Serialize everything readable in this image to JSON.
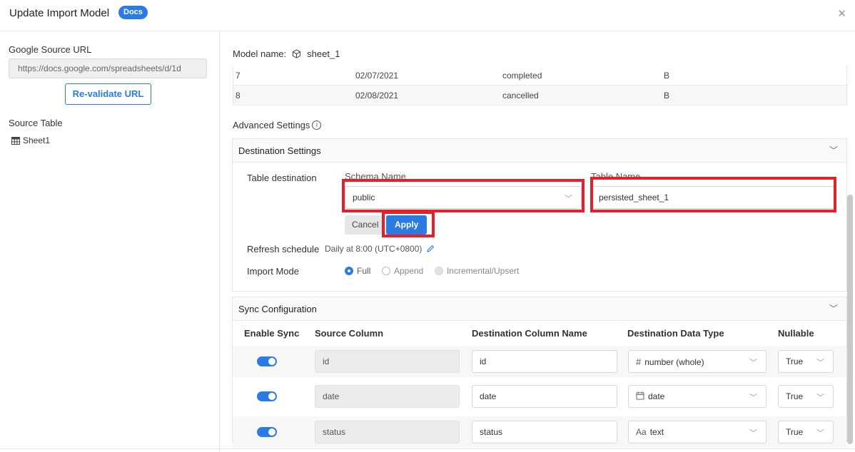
{
  "header": {
    "title": "Update Import Model",
    "docs_badge": "Docs",
    "close_icon": "close-icon"
  },
  "sidebar": {
    "google_source_label": "Google Source URL",
    "url_value": "https://docs.google.com/spreadsheets/d/1d",
    "revalidate_label": "Re-validate URL",
    "source_table_label": "Source Table",
    "sheet_name": "Sheet1"
  },
  "main": {
    "model_name_label": "Model name:",
    "model_name": "sheet_1",
    "preview_rows": [
      [
        "7",
        "02/07/2021",
        "completed",
        "B"
      ],
      [
        "8",
        "02/08/2021",
        "cancelled",
        "B"
      ]
    ],
    "advanced_settings": "Advanced Settings"
  },
  "destination": {
    "title": "Destination Settings",
    "table_destination_label": "Table destination",
    "schema_name_label": "Schema Name",
    "table_name_label": "Table Name",
    "schema_value": "public",
    "table_value": "persisted_sheet_1",
    "cancel_label": "Cancel",
    "apply_label": "Apply",
    "refresh_label": "Refresh schedule",
    "refresh_value": "Daily at 8:00 (UTC+0800)",
    "import_mode_label": "Import Mode",
    "modes": [
      "Full",
      "Append",
      "Incremental/Upsert"
    ],
    "selected_mode": "Full"
  },
  "sync": {
    "title": "Sync Configuration",
    "headers": [
      "Enable Sync",
      "Source Column",
      "Destination Column Name",
      "Destination Data Type",
      "Nullable"
    ],
    "rows": [
      {
        "source": "id",
        "dest": "id",
        "type_icon": "#",
        "type": "number (whole)",
        "nullable": "True"
      },
      {
        "source": "date",
        "dest": "date",
        "type_icon": "calendar-icon",
        "type": "date",
        "nullable": "True"
      },
      {
        "source": "status",
        "dest": "status",
        "type_icon": "Aa",
        "type": "text",
        "nullable": "True"
      }
    ]
  },
  "colors": {
    "accent": "#2c7be5",
    "highlight": "#e5202a"
  }
}
